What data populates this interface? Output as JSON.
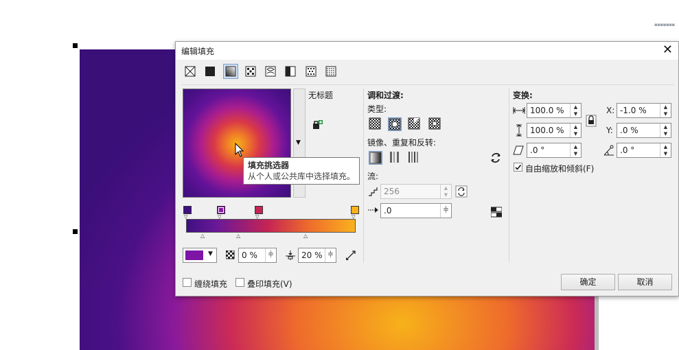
{
  "dialog": {
    "title": "编辑填充",
    "close_icon": "close-icon"
  },
  "fill_types": [
    "no-fill-icon",
    "uniform-fill-icon",
    "fountain-fill-icon",
    "vector-pattern-icon",
    "bitmap-pattern-icon",
    "two-color-pattern-icon",
    "texture-fill-icon",
    "postscript-fill-icon"
  ],
  "preview": {
    "fill_name": "无标题"
  },
  "tooltip": {
    "title": "填充挑选器",
    "description": "从个人或公共库中选择填充。"
  },
  "gradient": {
    "node_colors": [
      "#3e1080",
      "#8a1aa8",
      "#c42454",
      "#f9b21c"
    ],
    "color_swatch": "#7d16a6",
    "transparency": "0 %",
    "midpoint": "20 %"
  },
  "blend": {
    "header": "调和过渡:",
    "type_label": "类型:",
    "mirror_label": "镜像、重复和反转:",
    "flow_label": "流:",
    "steps_value": "256",
    "acceleration_value": ".0"
  },
  "transform": {
    "header": "变换:",
    "width_value": "100.0 %",
    "height_value": "100.0 %",
    "skew_value": ".0 °",
    "x_label": "X:",
    "x_value": "-1.0 %",
    "y_label": "Y:",
    "y_value": ".0 %",
    "rotate_value": ".0 °",
    "free_scale_label": "自由缩放和倾斜(F)",
    "free_scale_checked": true
  },
  "footer": {
    "wrap_fill_label": "缠绕填充",
    "overprint_label": "叠印填充(V)",
    "ok_label": "确定",
    "cancel_label": "取消"
  }
}
